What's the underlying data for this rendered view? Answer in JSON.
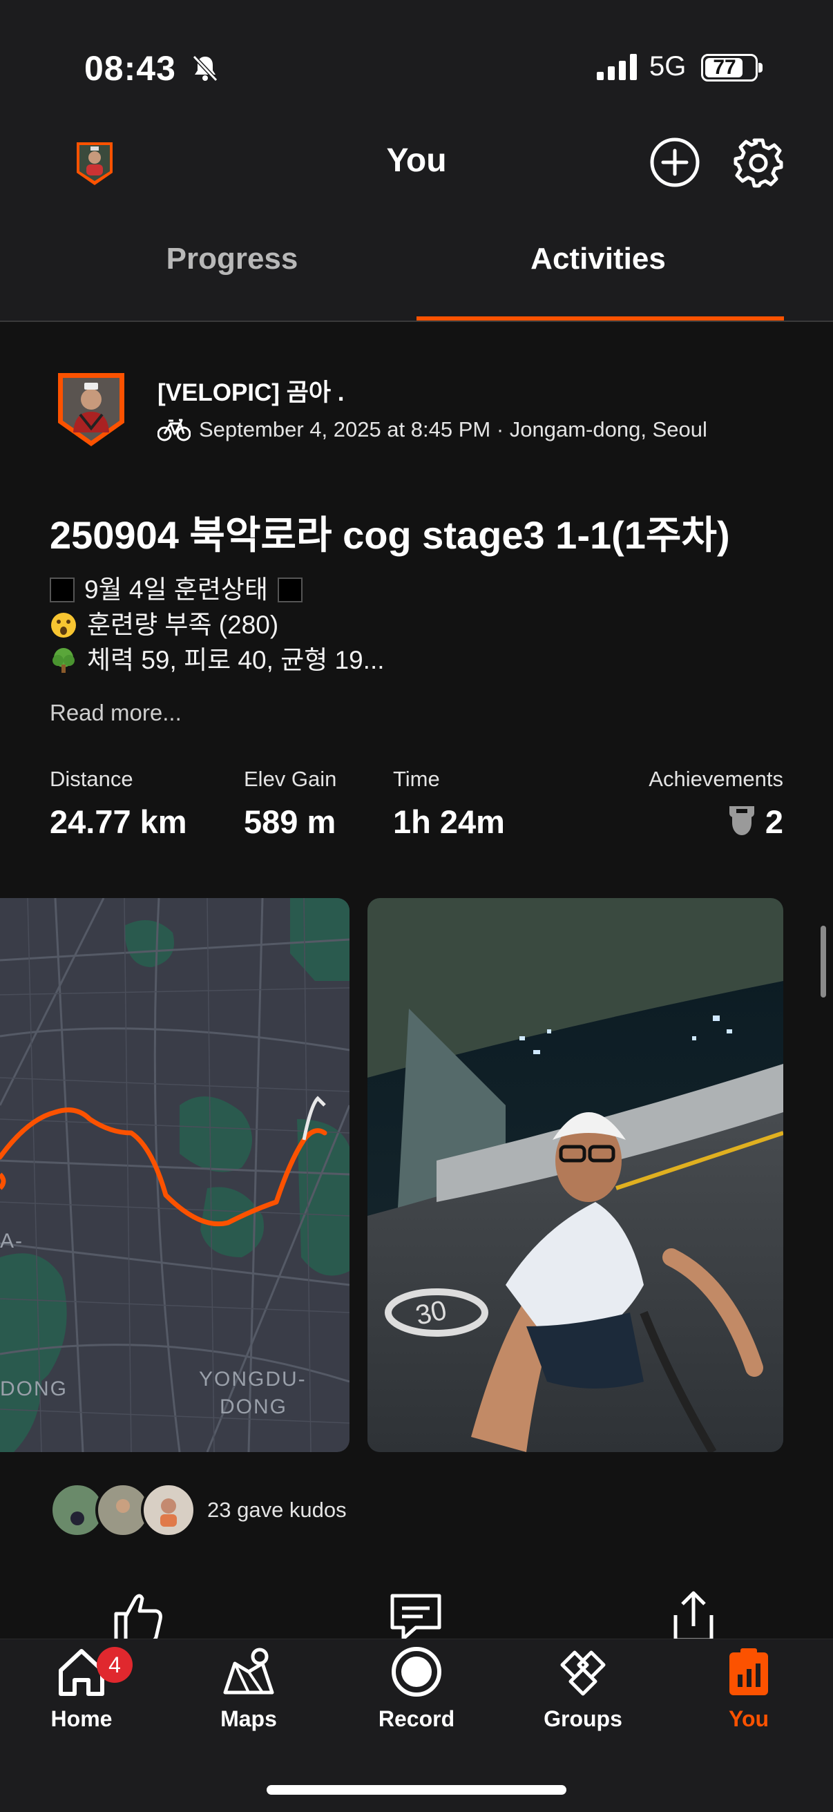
{
  "status_bar": {
    "time": "08:43",
    "network": "5G",
    "battery": "77",
    "battery_level": 0.77
  },
  "header": {
    "title": "You",
    "add_icon": "plus-circle-icon",
    "settings_icon": "gear-icon"
  },
  "tabs": [
    {
      "label": "Progress",
      "active": false
    },
    {
      "label": "Activities",
      "active": true
    }
  ],
  "activity": {
    "athlete_name": "[VELOPIC] 곰아 .",
    "meta": "September 4, 2025 at 8:45 PM · Jongam-dong, Seoul",
    "sport_icon": "bike-icon",
    "title": "250904 북악로라 cog stage3 1-1(1주차)",
    "description": [
      "9월 4일 훈련상태",
      "훈련량 부족 (280)",
      "체력 59, 피로 40, 균형 19..."
    ],
    "read_more": "Read more...",
    "stats": [
      {
        "label": "Distance",
        "value": "24.77 km"
      },
      {
        "label": "Elev Gain",
        "value": "589 m"
      },
      {
        "label": "Time",
        "value": "1h 24m"
      },
      {
        "label": "Achievements",
        "value": "2"
      }
    ],
    "map_labels": [
      "A-",
      "DONG",
      "YONGDU-",
      "DONG"
    ],
    "kudos_text": "23 gave kudos"
  },
  "tabbar": {
    "items": [
      {
        "label": "Home",
        "icon": "home-icon",
        "badge": "4"
      },
      {
        "label": "Maps",
        "icon": "map-icon"
      },
      {
        "label": "Record",
        "icon": "record-icon"
      },
      {
        "label": "Groups",
        "icon": "groups-icon"
      },
      {
        "label": "You",
        "icon": "you-icon",
        "active": true
      }
    ]
  },
  "colors": {
    "accent": "#fc5200",
    "background": "#121212",
    "bar": "#1c1c1e",
    "badge": "#e0282e"
  }
}
